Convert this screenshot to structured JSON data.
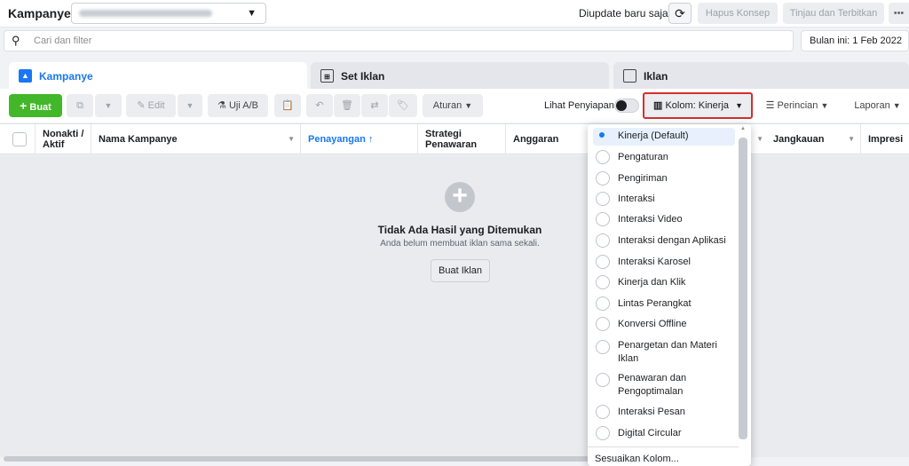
{
  "header": {
    "title": "Kampanye",
    "updated": "Diupdate baru saja",
    "hapus_konsep": "Hapus Konsep",
    "tinjau": "Tinjau dan Terbitkan",
    "more": "•••"
  },
  "search": {
    "placeholder": "Cari dan filter"
  },
  "date_range": "Bulan ini: 1 Feb 2022",
  "tabs": [
    {
      "label": "Kampanye"
    },
    {
      "label": "Set Iklan"
    },
    {
      "label": "Iklan"
    }
  ],
  "toolbar": {
    "buat": "Buat",
    "edit": "Edit",
    "uji_ab": "Uji A/B",
    "aturan": "Aturan",
    "lihat_penyiapan": "Lihat Penyiapan",
    "kolom": "Kolom: Kinerja",
    "perincian": "Perincian",
    "laporan": "Laporan"
  },
  "columns": [
    "Nonakti / Aktif",
    "Nama Kampanye",
    "Penayangan ↑",
    "Strategi Penawaran",
    "Anggaran",
    "Jangkauan",
    "Impresi"
  ],
  "empty": {
    "title": "Tidak Ada Hasil yang Ditemukan",
    "subtitle": "Anda belum membuat iklan sama sekali.",
    "button": "Buat Iklan"
  },
  "column_presets": {
    "selected": 0,
    "options": [
      "Kinerja (Default)",
      "Pengaturan",
      "Pengiriman",
      "Interaksi",
      "Interaksi Video",
      "Interaksi dengan Aplikasi",
      "Interaksi Karosel",
      "Kinerja dan Klik",
      "Lintas Perangkat",
      "Konversi Offline",
      "Penargetan dan Materi Iklan",
      "Penawaran dan Pengoptimalan",
      "Interaksi Pesan",
      "Digital Circular"
    ],
    "footer": "Sesuaikan Kolom..."
  },
  "colors": {
    "accent": "#1877f2",
    "green": "#42b72a",
    "highlight": "#d32f2f"
  }
}
